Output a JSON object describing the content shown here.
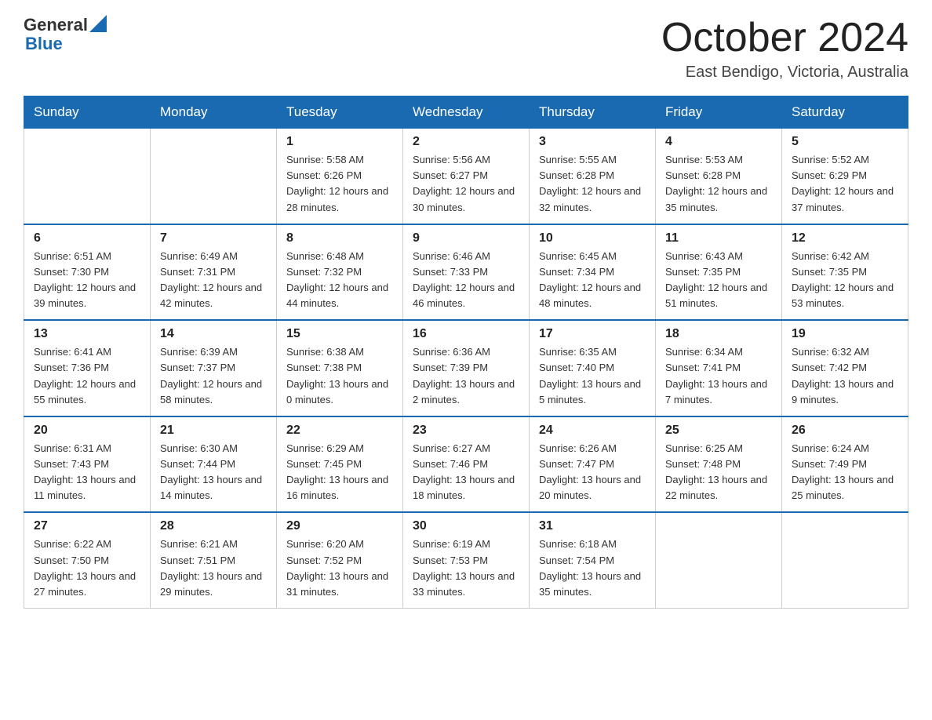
{
  "header": {
    "logo_general": "General",
    "logo_blue": "Blue",
    "month": "October 2024",
    "location": "East Bendigo, Victoria, Australia"
  },
  "weekdays": [
    "Sunday",
    "Monday",
    "Tuesday",
    "Wednesday",
    "Thursday",
    "Friday",
    "Saturday"
  ],
  "weeks": [
    [
      {
        "day": "",
        "info": ""
      },
      {
        "day": "",
        "info": ""
      },
      {
        "day": "1",
        "info": "Sunrise: 5:58 AM\nSunset: 6:26 PM\nDaylight: 12 hours\nand 28 minutes."
      },
      {
        "day": "2",
        "info": "Sunrise: 5:56 AM\nSunset: 6:27 PM\nDaylight: 12 hours\nand 30 minutes."
      },
      {
        "day": "3",
        "info": "Sunrise: 5:55 AM\nSunset: 6:28 PM\nDaylight: 12 hours\nand 32 minutes."
      },
      {
        "day": "4",
        "info": "Sunrise: 5:53 AM\nSunset: 6:28 PM\nDaylight: 12 hours\nand 35 minutes."
      },
      {
        "day": "5",
        "info": "Sunrise: 5:52 AM\nSunset: 6:29 PM\nDaylight: 12 hours\nand 37 minutes."
      }
    ],
    [
      {
        "day": "6",
        "info": "Sunrise: 6:51 AM\nSunset: 7:30 PM\nDaylight: 12 hours\nand 39 minutes."
      },
      {
        "day": "7",
        "info": "Sunrise: 6:49 AM\nSunset: 7:31 PM\nDaylight: 12 hours\nand 42 minutes."
      },
      {
        "day": "8",
        "info": "Sunrise: 6:48 AM\nSunset: 7:32 PM\nDaylight: 12 hours\nand 44 minutes."
      },
      {
        "day": "9",
        "info": "Sunrise: 6:46 AM\nSunset: 7:33 PM\nDaylight: 12 hours\nand 46 minutes."
      },
      {
        "day": "10",
        "info": "Sunrise: 6:45 AM\nSunset: 7:34 PM\nDaylight: 12 hours\nand 48 minutes."
      },
      {
        "day": "11",
        "info": "Sunrise: 6:43 AM\nSunset: 7:35 PM\nDaylight: 12 hours\nand 51 minutes."
      },
      {
        "day": "12",
        "info": "Sunrise: 6:42 AM\nSunset: 7:35 PM\nDaylight: 12 hours\nand 53 minutes."
      }
    ],
    [
      {
        "day": "13",
        "info": "Sunrise: 6:41 AM\nSunset: 7:36 PM\nDaylight: 12 hours\nand 55 minutes."
      },
      {
        "day": "14",
        "info": "Sunrise: 6:39 AM\nSunset: 7:37 PM\nDaylight: 12 hours\nand 58 minutes."
      },
      {
        "day": "15",
        "info": "Sunrise: 6:38 AM\nSunset: 7:38 PM\nDaylight: 13 hours\nand 0 minutes."
      },
      {
        "day": "16",
        "info": "Sunrise: 6:36 AM\nSunset: 7:39 PM\nDaylight: 13 hours\nand 2 minutes."
      },
      {
        "day": "17",
        "info": "Sunrise: 6:35 AM\nSunset: 7:40 PM\nDaylight: 13 hours\nand 5 minutes."
      },
      {
        "day": "18",
        "info": "Sunrise: 6:34 AM\nSunset: 7:41 PM\nDaylight: 13 hours\nand 7 minutes."
      },
      {
        "day": "19",
        "info": "Sunrise: 6:32 AM\nSunset: 7:42 PM\nDaylight: 13 hours\nand 9 minutes."
      }
    ],
    [
      {
        "day": "20",
        "info": "Sunrise: 6:31 AM\nSunset: 7:43 PM\nDaylight: 13 hours\nand 11 minutes."
      },
      {
        "day": "21",
        "info": "Sunrise: 6:30 AM\nSunset: 7:44 PM\nDaylight: 13 hours\nand 14 minutes."
      },
      {
        "day": "22",
        "info": "Sunrise: 6:29 AM\nSunset: 7:45 PM\nDaylight: 13 hours\nand 16 minutes."
      },
      {
        "day": "23",
        "info": "Sunrise: 6:27 AM\nSunset: 7:46 PM\nDaylight: 13 hours\nand 18 minutes."
      },
      {
        "day": "24",
        "info": "Sunrise: 6:26 AM\nSunset: 7:47 PM\nDaylight: 13 hours\nand 20 minutes."
      },
      {
        "day": "25",
        "info": "Sunrise: 6:25 AM\nSunset: 7:48 PM\nDaylight: 13 hours\nand 22 minutes."
      },
      {
        "day": "26",
        "info": "Sunrise: 6:24 AM\nSunset: 7:49 PM\nDaylight: 13 hours\nand 25 minutes."
      }
    ],
    [
      {
        "day": "27",
        "info": "Sunrise: 6:22 AM\nSunset: 7:50 PM\nDaylight: 13 hours\nand 27 minutes."
      },
      {
        "day": "28",
        "info": "Sunrise: 6:21 AM\nSunset: 7:51 PM\nDaylight: 13 hours\nand 29 minutes."
      },
      {
        "day": "29",
        "info": "Sunrise: 6:20 AM\nSunset: 7:52 PM\nDaylight: 13 hours\nand 31 minutes."
      },
      {
        "day": "30",
        "info": "Sunrise: 6:19 AM\nSunset: 7:53 PM\nDaylight: 13 hours\nand 33 minutes."
      },
      {
        "day": "31",
        "info": "Sunrise: 6:18 AM\nSunset: 7:54 PM\nDaylight: 13 hours\nand 35 minutes."
      },
      {
        "day": "",
        "info": ""
      },
      {
        "day": "",
        "info": ""
      }
    ]
  ]
}
